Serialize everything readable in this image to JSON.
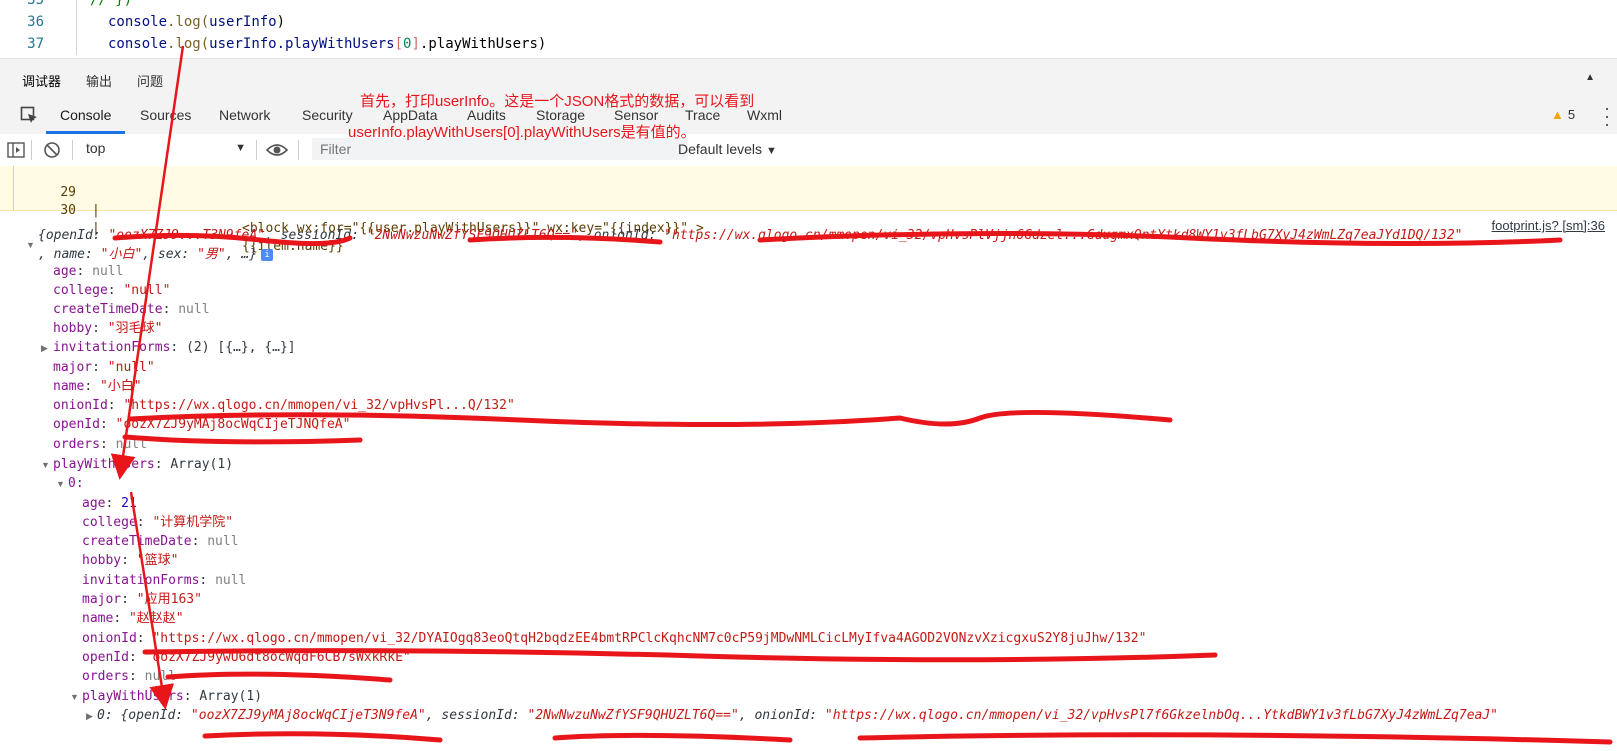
{
  "editor": {
    "lines": [
      {
        "num": "35",
        "text": "// })"
      },
      {
        "num": "36",
        "code_a": "console",
        "code_b": ".log(",
        "code_c": "userInfo",
        "code_d": ")"
      },
      {
        "num": "37",
        "code_a": "console",
        "code_b": ".log(",
        "code_c": "userInfo.playWithUsers",
        "code_idx": "0",
        "code_e": ".playWithUsers)"
      }
    ]
  },
  "panel_tabs": [
    "调试器",
    "输出",
    "问题"
  ],
  "devtools_tabs": [
    "Console",
    "Sources",
    "Network",
    "Security",
    "AppData",
    "Audits",
    "Storage",
    "Sensor",
    "Trace",
    "Wxml"
  ],
  "active_devtools_tab": "Console",
  "warnings_count": "5",
  "toolbar": {
    "context": "top",
    "filter_placeholder": "Filter",
    "levels": "Default levels"
  },
  "snippet": {
    "lines": [
      {
        "num": "29",
        "text": "<block wx:for=\"{{user.playWithUsers}}\" wx:key=\"{{index}}\" >"
      },
      {
        "num": "30",
        "text": "{{item.name}}"
      }
    ]
  },
  "console": {
    "source": "footprint.js? [sm]:36",
    "summary_prefix": "{openId: ",
    "summary_open": "\"oozX7ZJ9...T3N9feA\"",
    "summary_session_key": ", sessionId: ",
    "summary_session": "\"2NwNwzuNwZfYSF9QHUZLT6Q==\"",
    "summary_onion_key": ", onionId: ",
    "summary_onion": "\"https://wx.qlogo.cn/mmopen/vi_32/vpHvsPlVjjn6Gdzel...GdugmxQntYtkd8WY1v3fLbG7XyJ4zWmLZq7eaJYd1DQ/132\"",
    "summary_tail_a": ", name: ",
    "summary_name": "\"小白\"",
    "summary_tail_b": ", sex: ",
    "summary_sex": "\"男\"",
    "summary_tail_c": ", …}",
    "props": [
      {
        "k": "age",
        "v": "null",
        "t": "null"
      },
      {
        "k": "college",
        "v": "\"null\"",
        "t": "str"
      },
      {
        "k": "createTimeDate",
        "v": "null",
        "t": "null"
      },
      {
        "k": "hobby",
        "v": "\"羽毛球\"",
        "t": "str"
      },
      {
        "k": "invitationForms",
        "v": "(2) [{…}, {…}]",
        "t": "plain"
      },
      {
        "k": "major",
        "v": "\"null\"",
        "t": "str"
      },
      {
        "k": "name",
        "v": "\"小白\"",
        "t": "str"
      },
      {
        "k": "onionId",
        "v": "\"https://wx.qlogo.cn/mmopen/vi_32/vpHvsPl...Q/132\"",
        "t": "str"
      },
      {
        "k": "openId",
        "v": "\"oozX7ZJ9yMAj8ocWqCIjeTJNQfeA\"",
        "t": "str"
      },
      {
        "k": "orders",
        "v": "null",
        "t": "null"
      }
    ],
    "play_key": "playWithUsers",
    "play_val": "Array(1)",
    "index0": "0:",
    "inner_props": [
      {
        "k": "age",
        "v": "21",
        "t": "num"
      },
      {
        "k": "college",
        "v": "\"计算机学院\"",
        "t": "str"
      },
      {
        "k": "createTimeDate",
        "v": "null",
        "t": "null"
      },
      {
        "k": "hobby",
        "v": "\"篮球\"",
        "t": "str"
      },
      {
        "k": "invitationForms",
        "v": "null",
        "t": "null"
      },
      {
        "k": "major",
        "v": "\"应用163\"",
        "t": "str"
      },
      {
        "k": "name",
        "v": "\"赵赵赵\"",
        "t": "str"
      },
      {
        "k": "onionId",
        "v": "\"https://wx.qlogo.cn/mmopen/vi_32/DYAIOgq83eoQtqH2bqdzEE4bmtRPClcKqhcNM7c0cP59jMDwNMLCicLMyIfva4AGOD2VONzvXzicgxuS2Y8juJhw/132\"",
        "t": "str"
      },
      {
        "k": "openId",
        "v": "\"oozX7ZJ9ywU6dt8ocWqdF6CB7sWxkRkE\"",
        "t": "str"
      },
      {
        "k": "orders",
        "v": "null",
        "t": "null"
      }
    ],
    "inner_play_key": "playWithUsers",
    "inner_play_val": "Array(1)",
    "last_row_prefix": "0: {openId: ",
    "last_open": "\"oozX7ZJ9yMAj8ocWqCIjeT3N9feA\"",
    "last_session_key": ", sessionId: ",
    "last_session": "\"2NwNwzuNwZfYSF9QHUZLT6Q==\"",
    "last_onion_key": ", onionId: ",
    "last_onion": "\"https://wx.qlogo.cn/mmopen/vi_32/vpHvsPl7f6GkzelnbOq...YtkdBWY1v3fLbG7XyJ4zWmLZq7eaJ\""
  },
  "annotation": {
    "line1": "首先，打印userInfo。这是一个JSON格式的数据，可以看到",
    "line2": "userInfo.playWithUsers[0].playWithUsers是有值的。"
  },
  "colors": {
    "accent": "#1a73e8",
    "annotation_red": "#e8161b",
    "snippet_bg": "#fffbe5"
  }
}
